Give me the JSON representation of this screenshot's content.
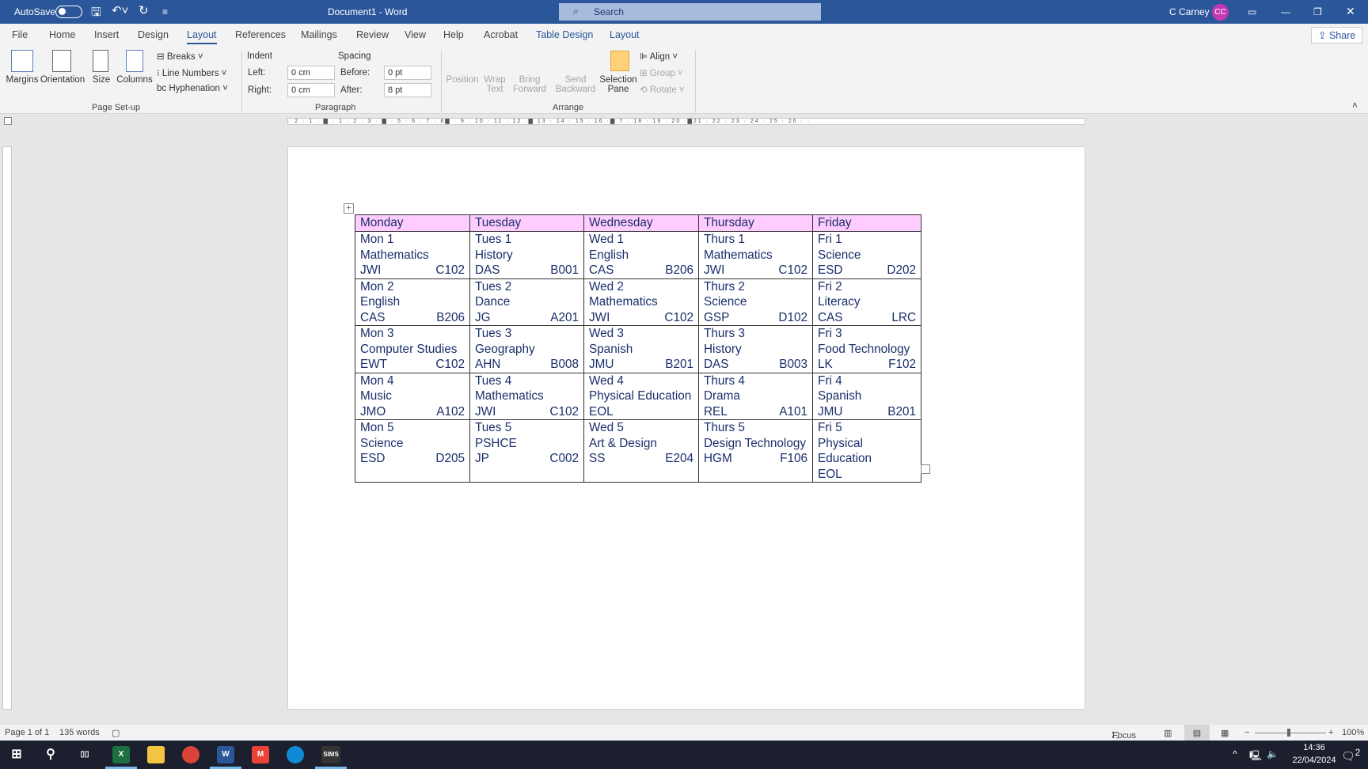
{
  "titlebar": {
    "autosave": "AutoSave",
    "title": "Document1  -  Word",
    "search": "Search",
    "user": "C Carney",
    "initials": "CC"
  },
  "tabs": [
    "File",
    "Home",
    "Insert",
    "Design",
    "Layout",
    "References",
    "Mailings",
    "Review",
    "View",
    "Help",
    "Acrobat",
    "Table Design",
    "Layout"
  ],
  "share": "Share",
  "ribbon": {
    "page_setup": {
      "margins": "Margins",
      "orientation": "Orientation",
      "size": "Size",
      "columns": "Columns",
      "breaks": "Breaks",
      "line_numbers": "Line Numbers",
      "hyphenation": "Hyphenation",
      "group": "Page Set-up"
    },
    "paragraph": {
      "indent": "Indent",
      "spacing": "Spacing",
      "left_label": "Left:",
      "left_value": "0 cm",
      "right_label": "Right:",
      "right_value": "0 cm",
      "before_label": "Before:",
      "before_value": "0 pt",
      "after_label": "After:",
      "after_value": "8 pt",
      "group": "Paragraph"
    },
    "arrange": {
      "position": "Position",
      "wrap1": "Wrap",
      "wrap2": "Text",
      "bring1": "Bring",
      "bring2": "Forward",
      "send1": "Send",
      "send2": "Backward",
      "sel1": "Selection",
      "sel2": "Pane",
      "align": "Align",
      "group_btn": "Group",
      "rotate": "Rotate",
      "group": "Arrange"
    }
  },
  "ruler_text": "· 2 · 1 · ▇ · 1 · 2 · 3 · ▇ · 5 · 6 · 7 · 8▇ · 9 · 10 · 11 · 12 ·▇ 13 · 14 · 15 · 16 ·▇ 7 · 18 · 19 · 20 ·▇21 · 22 · 23 · 24 · 25 · 26 · ·",
  "table": {
    "headers": [
      "Monday",
      "Tuesday",
      "Wednesday",
      "Thursday",
      "Friday"
    ],
    "rows": [
      [
        [
          "Mon 1",
          "Mathematics",
          "JWI",
          "C102"
        ],
        [
          "Tues 1",
          "History",
          "DAS",
          "B001"
        ],
        [
          "Wed 1",
          "English",
          "CAS",
          "B206"
        ],
        [
          "Thurs 1",
          "Mathematics",
          "JWI",
          "C102"
        ],
        [
          "Fri 1",
          "Science",
          "ESD",
          "D202"
        ]
      ],
      [
        [
          "Mon 2",
          "English",
          "CAS",
          "B206"
        ],
        [
          "Tues 2",
          "Dance",
          "JG",
          "A201"
        ],
        [
          "Wed 2",
          "Mathematics",
          "JWI",
          "C102"
        ],
        [
          "Thurs 2",
          "Science",
          "GSP",
          "D102"
        ],
        [
          "Fri 2",
          "Literacy",
          "CAS",
          "LRC"
        ]
      ],
      [
        [
          "Mon 3",
          "Computer Studies",
          "EWT",
          "C102"
        ],
        [
          "Tues 3",
          "Geography",
          "AHN",
          "B008"
        ],
        [
          "Wed 3",
          "Spanish",
          "JMU",
          "B201"
        ],
        [
          "Thurs 3",
          "History",
          "DAS",
          "B003"
        ],
        [
          "Fri 3",
          "Food Technology",
          "LK",
          "F102"
        ]
      ],
      [
        [
          "Mon 4",
          "Music",
          "JMO",
          "A102"
        ],
        [
          "Tues 4",
          "Mathematics",
          "JWI",
          "C102"
        ],
        [
          "Wed 4",
          "Physical Education",
          "EOL",
          ""
        ],
        [
          "Thurs 4",
          "Drama",
          "REL",
          "A101"
        ],
        [
          "Fri 4",
          "Spanish",
          "JMU",
          "B201"
        ]
      ],
      [
        [
          "Mon 5",
          "Science",
          "ESD",
          "D205"
        ],
        [
          "Tues 5",
          "PSHCE",
          "JP",
          "C002"
        ],
        [
          "Wed 5",
          "Art & Design",
          "SS",
          "E204"
        ],
        [
          "Thurs 5",
          "Design Technology",
          "HGM",
          "F106"
        ],
        [
          "Fri 5",
          "Physical Education",
          "EOL",
          ""
        ]
      ]
    ],
    "header_color": "#ffccff"
  },
  "status": {
    "page": "Page 1 of 1",
    "words": "135 words",
    "focus": "Focus",
    "zoom": "100%"
  },
  "taskbar": {
    "time": "14:36",
    "date": "22/04/2024",
    "notifications": "2",
    "sims": "SIMS"
  }
}
